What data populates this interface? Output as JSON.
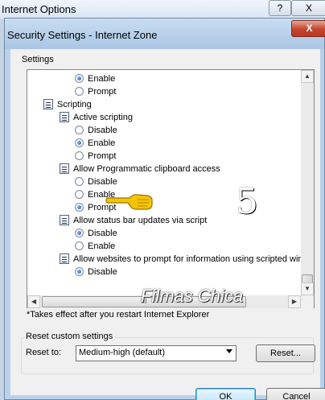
{
  "window": {
    "title": "Internet Options",
    "help_glyph": "?",
    "close_glyph": "X"
  },
  "dialog": {
    "title": "Security Settings - Internet Zone",
    "close_glyph": "X",
    "settings_label": "Settings",
    "list_rows": [
      {
        "kind": "radio",
        "label": "Enable",
        "checked": true
      },
      {
        "kind": "radio",
        "label": "Prompt",
        "checked": false
      },
      {
        "kind": "category",
        "label": "Scripting",
        "icon": "scripting-icon"
      },
      {
        "kind": "category",
        "label": "Active scripting",
        "icon": "setting-icon"
      },
      {
        "kind": "radio",
        "label": "Disable",
        "checked": false
      },
      {
        "kind": "radio",
        "label": "Enable",
        "checked": true
      },
      {
        "kind": "radio",
        "label": "Prompt",
        "checked": false
      },
      {
        "kind": "category",
        "label": "Allow Programmatic clipboard access",
        "icon": "setting-icon"
      },
      {
        "kind": "radio",
        "label": "Disable",
        "checked": false
      },
      {
        "kind": "radio",
        "label": "Enable",
        "checked": false
      },
      {
        "kind": "radio",
        "label": "Prompt",
        "checked": true
      },
      {
        "kind": "category",
        "label": "Allow status bar updates via script",
        "icon": "setting-icon"
      },
      {
        "kind": "radio",
        "label": "Disable",
        "checked": true
      },
      {
        "kind": "radio",
        "label": "Enable",
        "checked": false
      },
      {
        "kind": "category",
        "label": "Allow websites to prompt for information using scripted windo",
        "icon": "setting-icon"
      },
      {
        "kind": "radio",
        "label": "Disable",
        "checked": true
      }
    ],
    "note": "*Takes effect after you restart Internet Explorer",
    "hscroll_grip": "III",
    "reset_group": {
      "legend": "Reset custom settings",
      "reset_to_label": "Reset to:",
      "selected_level": "Medium-high (default)",
      "reset_button": "Reset..."
    },
    "ok_button": "OK",
    "cancel_button": "Cancel"
  },
  "overlay": {
    "watermark": "Filmas Chica",
    "digit": "5"
  },
  "colors": {
    "dialog_frame": "#b9d1ea",
    "close_red": "#c4432b",
    "radio_dot": "#1a56c5",
    "hand_yellow": "#f5c400"
  }
}
